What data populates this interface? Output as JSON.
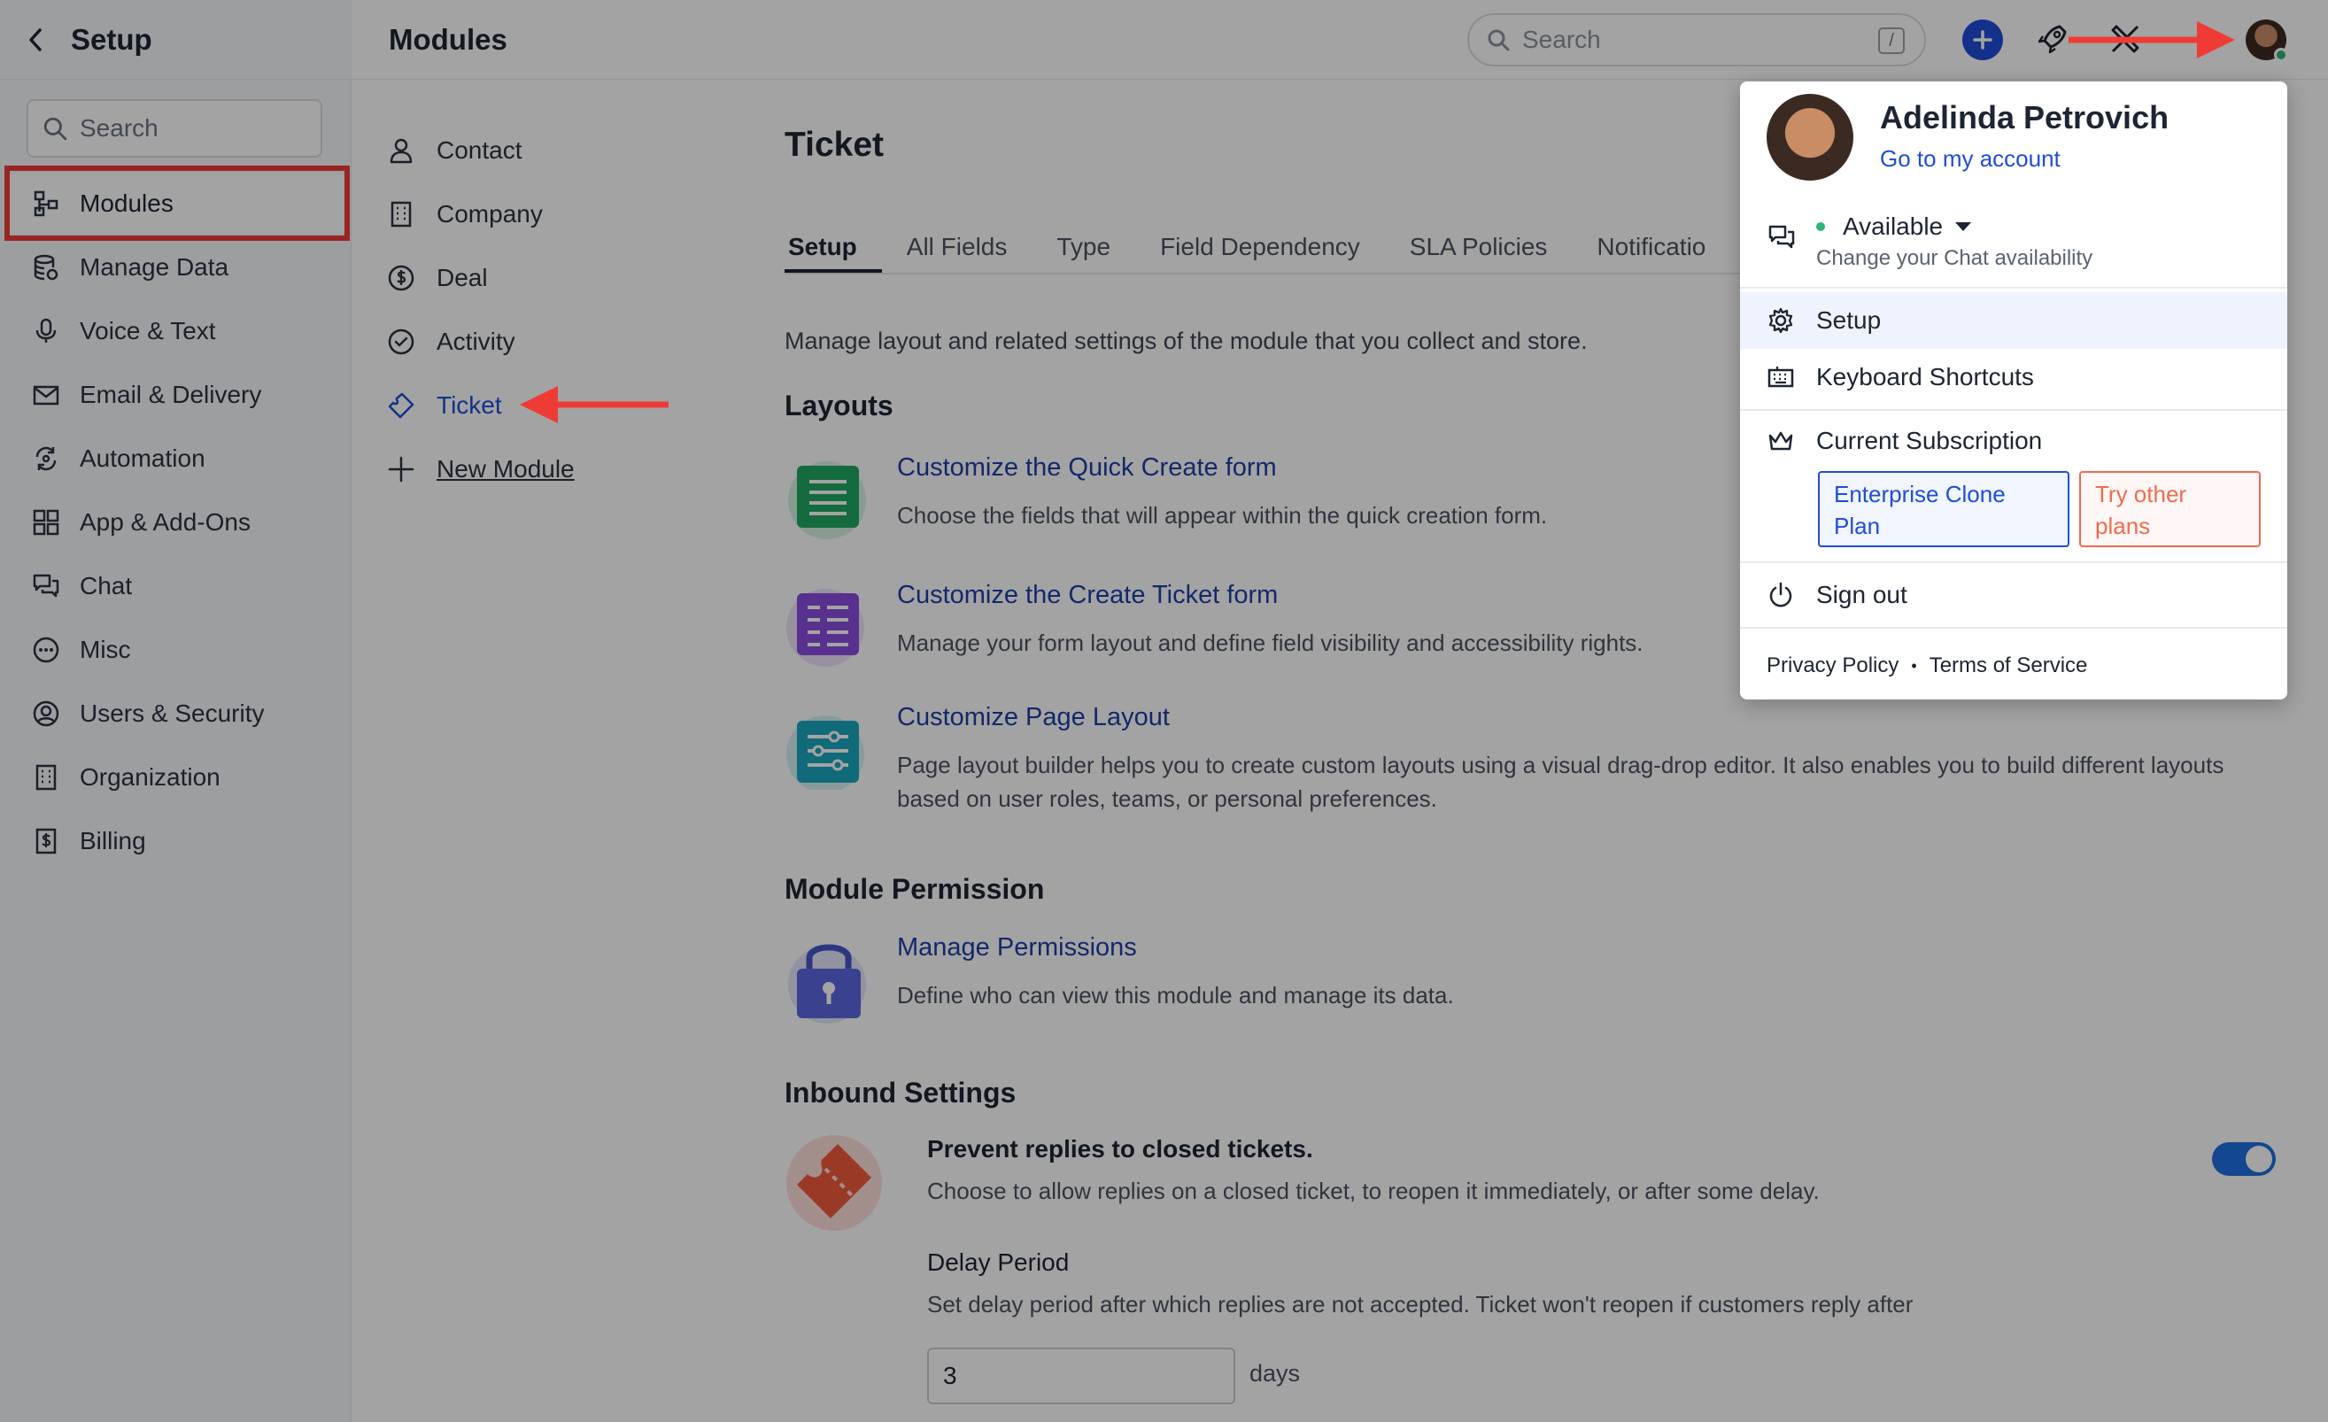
{
  "topbar": {
    "setup_title": "Setup",
    "modules_title": "Modules",
    "search_placeholder": "Search",
    "search_shortcut": "/"
  },
  "sidebar": {
    "search_placeholder": "Search",
    "items": [
      {
        "label": "Modules",
        "icon": "modules-icon"
      },
      {
        "label": "Manage Data",
        "icon": "database-icon"
      },
      {
        "label": "Voice & Text",
        "icon": "microphone-icon"
      },
      {
        "label": "Email & Delivery",
        "icon": "envelope-icon"
      },
      {
        "label": "Automation",
        "icon": "automation-icon"
      },
      {
        "label": "App & Add-Ons",
        "icon": "grid-icon"
      },
      {
        "label": "Chat",
        "icon": "chat-icon"
      },
      {
        "label": "Misc",
        "icon": "more-icon"
      },
      {
        "label": "Users & Security",
        "icon": "user-circle-icon"
      },
      {
        "label": "Organization",
        "icon": "building-icon"
      },
      {
        "label": "Billing",
        "icon": "billing-icon"
      }
    ]
  },
  "modules": {
    "items": [
      {
        "label": "Contact",
        "icon": "person-icon"
      },
      {
        "label": "Company",
        "icon": "building-icon"
      },
      {
        "label": "Deal",
        "icon": "dollar-icon"
      },
      {
        "label": "Activity",
        "icon": "check-circle-icon"
      },
      {
        "label": "Ticket",
        "icon": "ticket-icon"
      },
      {
        "label": "New Module",
        "icon": "plus-icon"
      }
    ]
  },
  "content": {
    "title": "Ticket",
    "tabs": [
      "Setup",
      "All Fields",
      "Type",
      "Field Dependency",
      "SLA Policies",
      "Notificatio"
    ],
    "intro": "Manage layout and related settings of the module that you collect and store.",
    "layouts_title": "Layouts",
    "layouts": [
      {
        "link": "Customize the Quick Create form",
        "desc": "Choose the fields that will appear within the quick creation form."
      },
      {
        "link": "Customize the Create Ticket form",
        "desc": "Manage your form layout and define field visibility and accessibility rights."
      },
      {
        "link": "Customize Page Layout",
        "desc": "Page layout builder helps you to create custom layouts using a visual drag-drop editor. It also enables you to build different layouts based on user roles, teams, or personal preferences."
      }
    ],
    "permission_title": "Module Permission",
    "permission": {
      "link": "Manage Permissions",
      "desc": "Define who can view this module and manage its data."
    },
    "inbound_title": "Inbound Settings",
    "inbound": {
      "title": "Prevent replies to closed tickets.",
      "desc": "Choose to allow replies on a closed ticket, to reopen it immediately, or after some delay.",
      "toggle_on": true,
      "delay_title": "Delay Period",
      "delay_desc": "Set delay period after which replies are not accepted. Ticket won't reopen if customers reply after",
      "delay_value": "3",
      "delay_unit": "days"
    }
  },
  "profile_menu": {
    "name": "Adelinda Petrovich",
    "account_link": "Go to my account",
    "status": "Available",
    "status_hint": "Change your Chat availability",
    "items": [
      "Setup",
      "Keyboard Shortcuts",
      "Current Subscription"
    ],
    "current_plan": "Enterprise Clone Plan",
    "other_plans": "Try other plans",
    "sign_out": "Sign out",
    "privacy": "Privacy Policy",
    "terms": "Terms of Service"
  },
  "colors": {
    "accent": "#1f4dd8",
    "highlight_red": "#ef3b36",
    "available_green": "#2bb673"
  }
}
